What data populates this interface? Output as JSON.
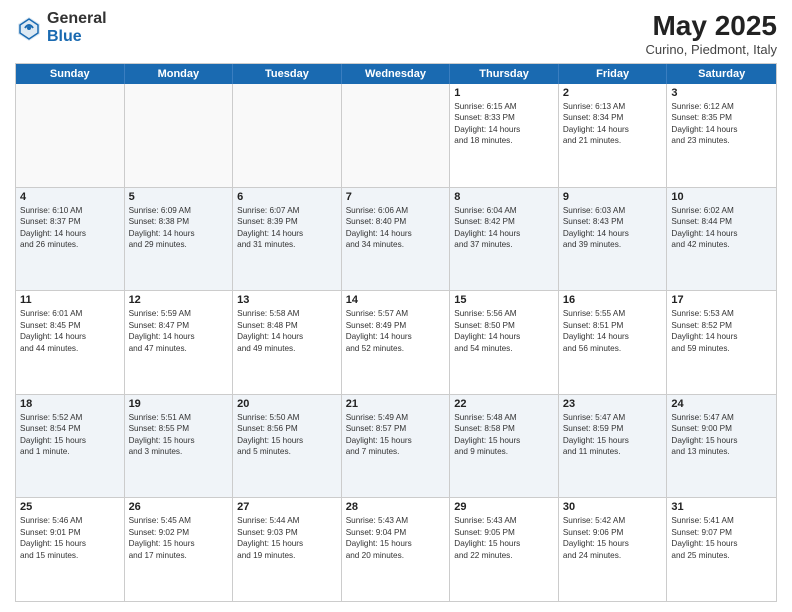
{
  "header": {
    "logo_general": "General",
    "logo_blue": "Blue",
    "month_title": "May 2025",
    "location": "Curino, Piedmont, Italy"
  },
  "days_of_week": [
    "Sunday",
    "Monday",
    "Tuesday",
    "Wednesday",
    "Thursday",
    "Friday",
    "Saturday"
  ],
  "weeks": [
    [
      {
        "day": "",
        "info": ""
      },
      {
        "day": "",
        "info": ""
      },
      {
        "day": "",
        "info": ""
      },
      {
        "day": "",
        "info": ""
      },
      {
        "day": "1",
        "info": "Sunrise: 6:15 AM\nSunset: 8:33 PM\nDaylight: 14 hours\nand 18 minutes."
      },
      {
        "day": "2",
        "info": "Sunrise: 6:13 AM\nSunset: 8:34 PM\nDaylight: 14 hours\nand 21 minutes."
      },
      {
        "day": "3",
        "info": "Sunrise: 6:12 AM\nSunset: 8:35 PM\nDaylight: 14 hours\nand 23 minutes."
      }
    ],
    [
      {
        "day": "4",
        "info": "Sunrise: 6:10 AM\nSunset: 8:37 PM\nDaylight: 14 hours\nand 26 minutes."
      },
      {
        "day": "5",
        "info": "Sunrise: 6:09 AM\nSunset: 8:38 PM\nDaylight: 14 hours\nand 29 minutes."
      },
      {
        "day": "6",
        "info": "Sunrise: 6:07 AM\nSunset: 8:39 PM\nDaylight: 14 hours\nand 31 minutes."
      },
      {
        "day": "7",
        "info": "Sunrise: 6:06 AM\nSunset: 8:40 PM\nDaylight: 14 hours\nand 34 minutes."
      },
      {
        "day": "8",
        "info": "Sunrise: 6:04 AM\nSunset: 8:42 PM\nDaylight: 14 hours\nand 37 minutes."
      },
      {
        "day": "9",
        "info": "Sunrise: 6:03 AM\nSunset: 8:43 PM\nDaylight: 14 hours\nand 39 minutes."
      },
      {
        "day": "10",
        "info": "Sunrise: 6:02 AM\nSunset: 8:44 PM\nDaylight: 14 hours\nand 42 minutes."
      }
    ],
    [
      {
        "day": "11",
        "info": "Sunrise: 6:01 AM\nSunset: 8:45 PM\nDaylight: 14 hours\nand 44 minutes."
      },
      {
        "day": "12",
        "info": "Sunrise: 5:59 AM\nSunset: 8:47 PM\nDaylight: 14 hours\nand 47 minutes."
      },
      {
        "day": "13",
        "info": "Sunrise: 5:58 AM\nSunset: 8:48 PM\nDaylight: 14 hours\nand 49 minutes."
      },
      {
        "day": "14",
        "info": "Sunrise: 5:57 AM\nSunset: 8:49 PM\nDaylight: 14 hours\nand 52 minutes."
      },
      {
        "day": "15",
        "info": "Sunrise: 5:56 AM\nSunset: 8:50 PM\nDaylight: 14 hours\nand 54 minutes."
      },
      {
        "day": "16",
        "info": "Sunrise: 5:55 AM\nSunset: 8:51 PM\nDaylight: 14 hours\nand 56 minutes."
      },
      {
        "day": "17",
        "info": "Sunrise: 5:53 AM\nSunset: 8:52 PM\nDaylight: 14 hours\nand 59 minutes."
      }
    ],
    [
      {
        "day": "18",
        "info": "Sunrise: 5:52 AM\nSunset: 8:54 PM\nDaylight: 15 hours\nand 1 minute."
      },
      {
        "day": "19",
        "info": "Sunrise: 5:51 AM\nSunset: 8:55 PM\nDaylight: 15 hours\nand 3 minutes."
      },
      {
        "day": "20",
        "info": "Sunrise: 5:50 AM\nSunset: 8:56 PM\nDaylight: 15 hours\nand 5 minutes."
      },
      {
        "day": "21",
        "info": "Sunrise: 5:49 AM\nSunset: 8:57 PM\nDaylight: 15 hours\nand 7 minutes."
      },
      {
        "day": "22",
        "info": "Sunrise: 5:48 AM\nSunset: 8:58 PM\nDaylight: 15 hours\nand 9 minutes."
      },
      {
        "day": "23",
        "info": "Sunrise: 5:47 AM\nSunset: 8:59 PM\nDaylight: 15 hours\nand 11 minutes."
      },
      {
        "day": "24",
        "info": "Sunrise: 5:47 AM\nSunset: 9:00 PM\nDaylight: 15 hours\nand 13 minutes."
      }
    ],
    [
      {
        "day": "25",
        "info": "Sunrise: 5:46 AM\nSunset: 9:01 PM\nDaylight: 15 hours\nand 15 minutes."
      },
      {
        "day": "26",
        "info": "Sunrise: 5:45 AM\nSunset: 9:02 PM\nDaylight: 15 hours\nand 17 minutes."
      },
      {
        "day": "27",
        "info": "Sunrise: 5:44 AM\nSunset: 9:03 PM\nDaylight: 15 hours\nand 19 minutes."
      },
      {
        "day": "28",
        "info": "Sunrise: 5:43 AM\nSunset: 9:04 PM\nDaylight: 15 hours\nand 20 minutes."
      },
      {
        "day": "29",
        "info": "Sunrise: 5:43 AM\nSunset: 9:05 PM\nDaylight: 15 hours\nand 22 minutes."
      },
      {
        "day": "30",
        "info": "Sunrise: 5:42 AM\nSunset: 9:06 PM\nDaylight: 15 hours\nand 24 minutes."
      },
      {
        "day": "31",
        "info": "Sunrise: 5:41 AM\nSunset: 9:07 PM\nDaylight: 15 hours\nand 25 minutes."
      }
    ]
  ]
}
